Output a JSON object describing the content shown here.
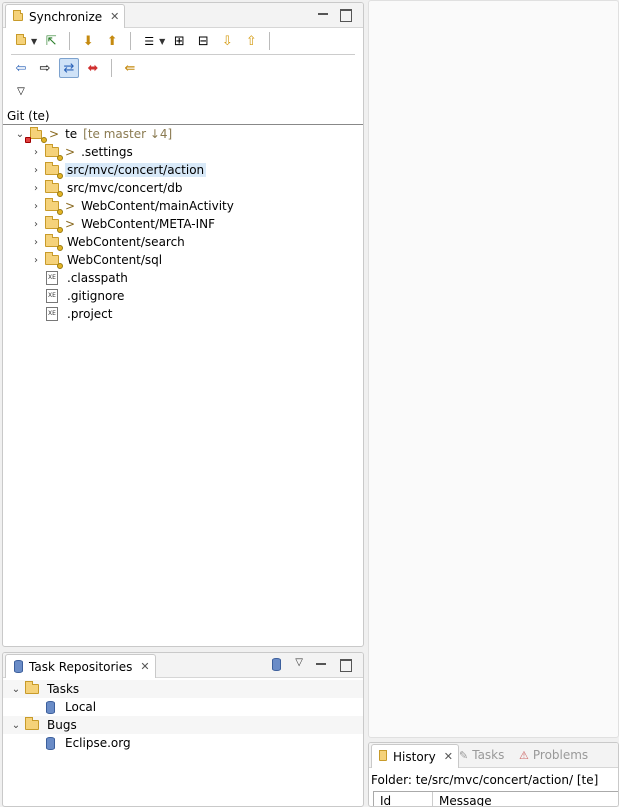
{
  "sync_view": {
    "tab_label": "Synchronize",
    "section_label": "Git (te)",
    "repo": {
      "name": "te",
      "branch_info": "[te master ↓4]",
      "dirty": ">"
    },
    "items": [
      {
        "label": ".settings",
        "dirty": ">",
        "type": "folder",
        "selected": false
      },
      {
        "label": "src/mvc/concert/action",
        "dirty": "",
        "type": "folder",
        "selected": true
      },
      {
        "label": "src/mvc/concert/db",
        "dirty": "",
        "type": "folder",
        "selected": false
      },
      {
        "label": "WebContent/mainActivity",
        "dirty": ">",
        "type": "folder",
        "selected": false
      },
      {
        "label": "WebContent/META-INF",
        "dirty": ">",
        "type": "folder",
        "selected": false
      },
      {
        "label": "WebContent/search",
        "dirty": "",
        "type": "folder",
        "selected": false
      },
      {
        "label": "WebContent/sql",
        "dirty": "",
        "type": "folder",
        "selected": false
      },
      {
        "label": ".classpath",
        "dirty": "",
        "type": "file",
        "selected": false
      },
      {
        "label": ".gitignore",
        "dirty": "",
        "type": "file",
        "selected": false
      },
      {
        "label": ".project",
        "dirty": "",
        "type": "file",
        "selected": false
      }
    ]
  },
  "task_view": {
    "tab_label": "Task Repositories",
    "groups": [
      {
        "label": "Tasks",
        "child": "Local"
      },
      {
        "label": "Bugs",
        "child": "Eclipse.org"
      }
    ]
  },
  "history_view": {
    "tabs": [
      "History",
      "Tasks",
      "Problems"
    ],
    "folder_line": "Folder: te/src/mvc/concert/action/ [te]",
    "columns": [
      "Id",
      "Message"
    ]
  },
  "colors": {
    "selection": "#d8e9f8",
    "folder": "#f5d27a",
    "branch_text": "#8a7a50"
  }
}
